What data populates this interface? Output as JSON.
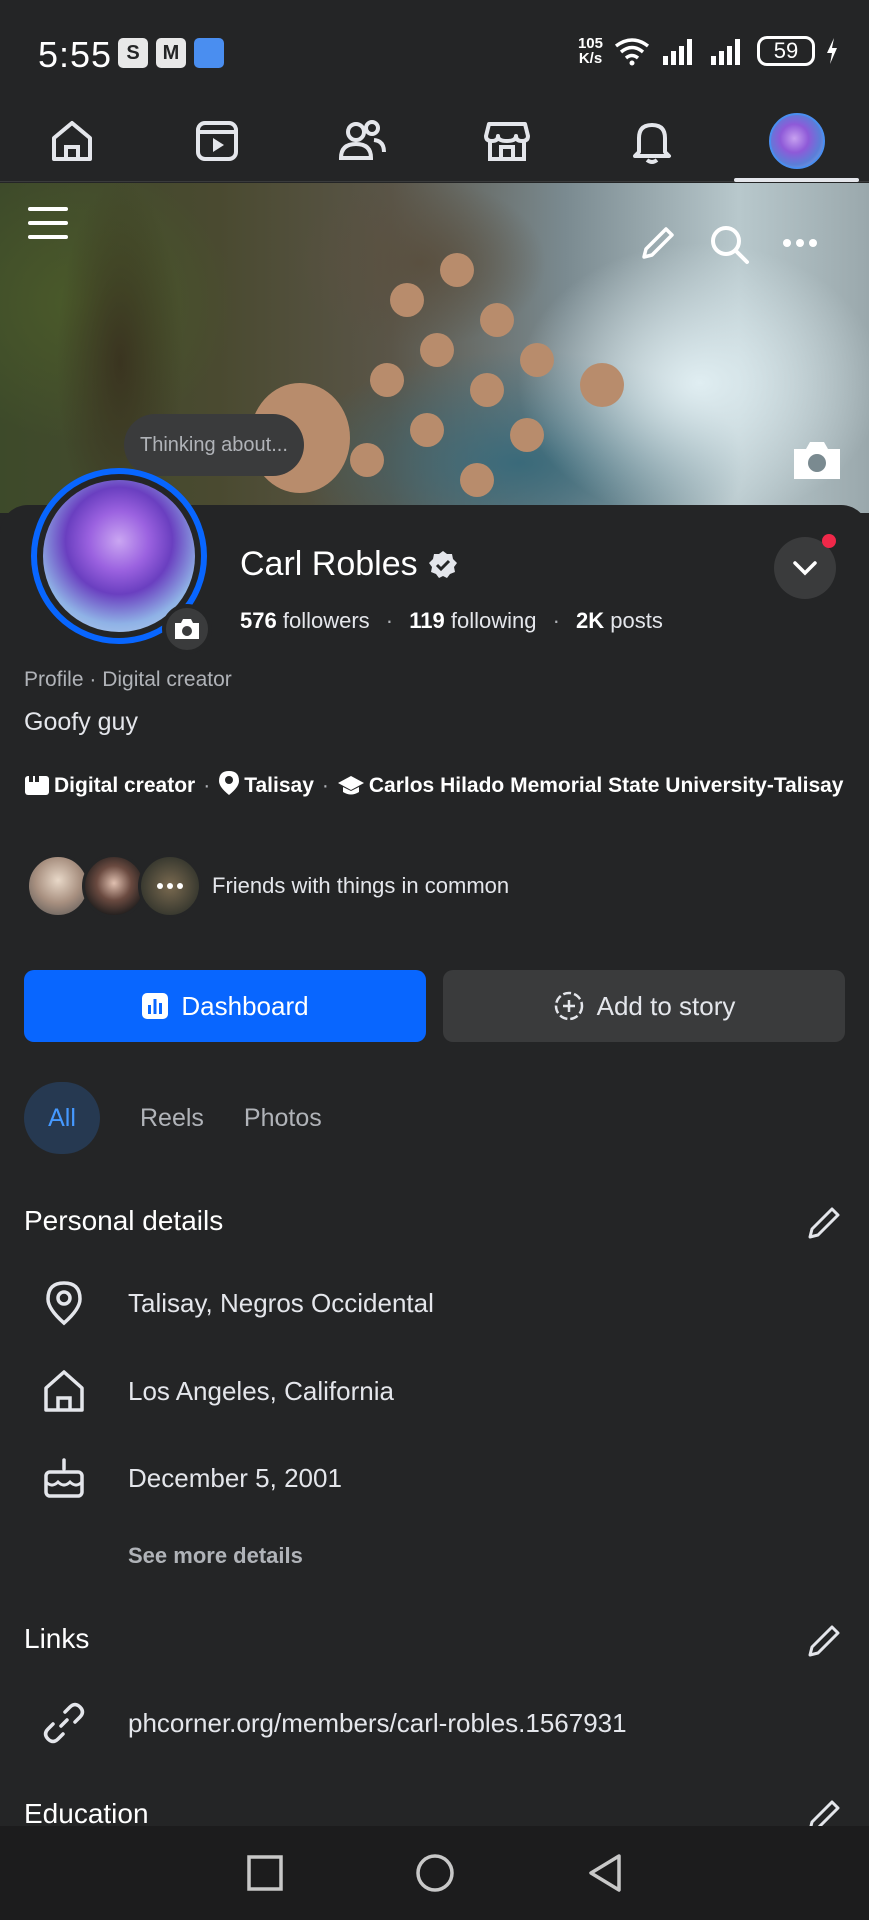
{
  "status_bar": {
    "time": "5:55",
    "net_speed_value": "105",
    "net_speed_unit": "K/s",
    "battery": "59"
  },
  "top_nav": {
    "items": [
      "home-icon",
      "video-icon",
      "friends-icon",
      "marketplace-icon",
      "bell-icon",
      "profile-avatar"
    ],
    "active": "profile-avatar"
  },
  "cover": {
    "thinking_placeholder": "Thinking about..."
  },
  "profile": {
    "name": "Carl Robles",
    "followers_count": "576",
    "followers_label": "followers",
    "following_count": "119",
    "following_label": "following",
    "posts_count": "2K",
    "posts_label": "posts",
    "type_profile": "Profile",
    "type_creator": "Digital creator",
    "bio": "Goofy guy",
    "info": {
      "job": "Digital creator",
      "location": "Talisay",
      "school": "Carlos Hilado Memorial State University-Talisay"
    },
    "friends_text": "Friends with things in common"
  },
  "actions": {
    "dashboard": "Dashboard",
    "add_story": "Add to story"
  },
  "tabs": [
    "All",
    "Reels",
    "Photos"
  ],
  "personal_details": {
    "title": "Personal details",
    "rows": [
      {
        "icon": "location-pin-icon",
        "text": "Talisay, Negros Occidental"
      },
      {
        "icon": "home-outline-icon",
        "text": "Los Angeles, California"
      },
      {
        "icon": "birthday-cake-icon",
        "text": "December 5, 2001"
      }
    ],
    "see_more": "See more details"
  },
  "links": {
    "title": "Links",
    "url": "phcorner.org/members/carl-robles.1567931"
  },
  "education": {
    "title": "Education"
  },
  "colors": {
    "background": "#242526",
    "accent": "#0866ff",
    "secondary_button": "#3a3b3c"
  }
}
